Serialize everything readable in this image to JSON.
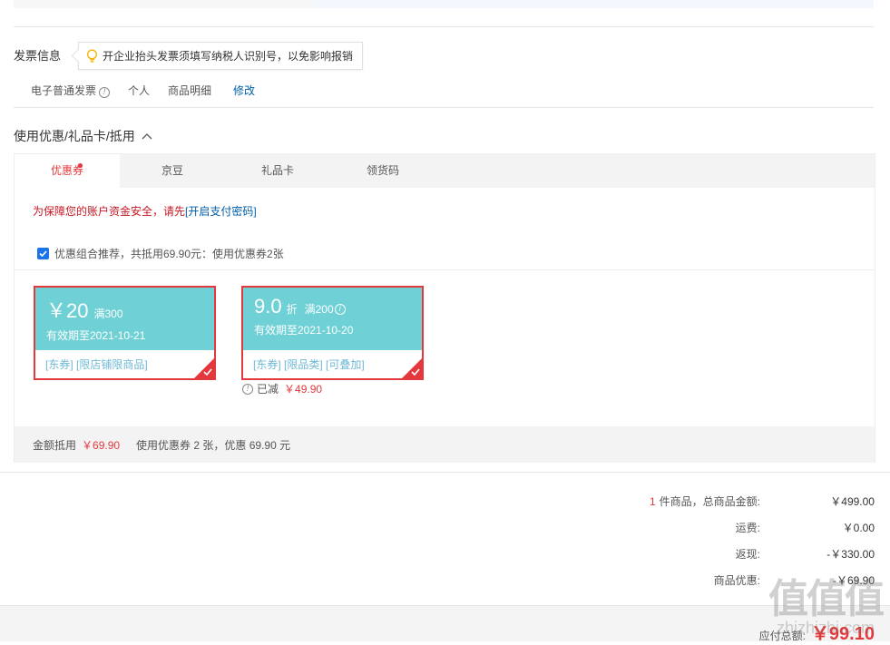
{
  "invoice": {
    "title": "发票信息",
    "tip": "开企业抬头发票须填写纳税人识别号，以免影响报销",
    "type": "电子普通发票",
    "info_icon": "!",
    "subject": "个人",
    "content": "商品明细",
    "edit_label": "修改"
  },
  "discount": {
    "title": "使用优惠/礼品卡/抵用",
    "tabs": [
      {
        "label": "优惠券"
      },
      {
        "label": "京豆"
      },
      {
        "label": "礼品卡"
      },
      {
        "label": "领货码"
      }
    ],
    "security_text": "为保障您的账户资金安全，请先",
    "security_link": "[开启支付密码]",
    "combo_text": "优惠组合推荐，共抵用69.90元：使用优惠券2张",
    "combo_checked": true,
    "coupons": [
      {
        "amount": "￥20",
        "condition": "满300",
        "expiry": "有效期至2021-10-21",
        "tags": "[东券]  [限店铺限商品]",
        "selected": true
      },
      {
        "amount": "9.0",
        "unit": "折",
        "condition": "满200",
        "expiry": "有效期至2021-10-20",
        "tags": "[东券]  [限品类]  [可叠加]",
        "selected": true
      }
    ],
    "reduced_label": "已减",
    "reduced_value": "￥49.90",
    "footer_label": "金额抵用",
    "footer_amount": "￥69.90",
    "footer_text": "使用优惠券 2 张，优惠 69.90 元"
  },
  "summary": {
    "item_count": "1",
    "items_label": "件商品，总商品金额:",
    "items_total": "￥499.00",
    "shipping_label": "运费:",
    "shipping": "￥0.00",
    "cashback_label": "返现:",
    "cashback": "-￥330.00",
    "discount_label": "商品优惠:",
    "discount": "-￥69.90",
    "payable_label": "应付总额:",
    "payable": "￥99.10"
  },
  "watermark": {
    "logo": "值值值",
    "url": "zhizhizhi.com"
  },
  "colors": {
    "accent": "#e4393c",
    "link": "#005ea7",
    "coupon": "#6fd1d6"
  }
}
